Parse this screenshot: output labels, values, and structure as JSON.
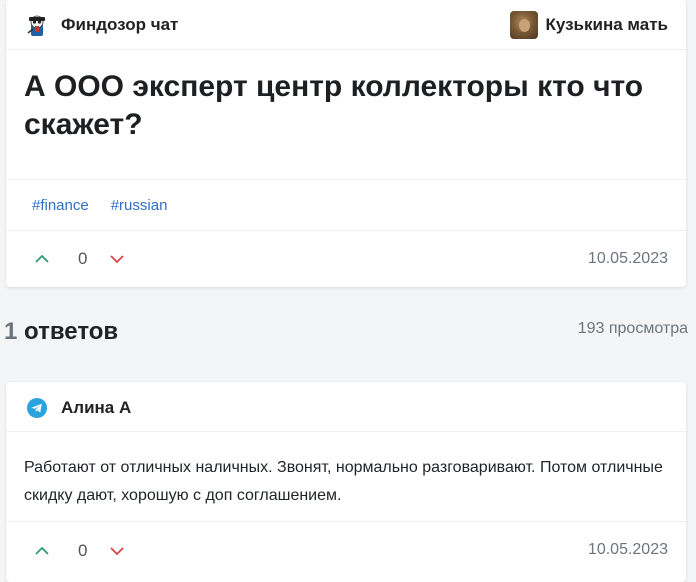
{
  "question": {
    "chat_name": "Финдозор чат",
    "author": "Кузькина мать",
    "title": "А ООО эксперт центр коллекторы кто что скажет?",
    "tags": [
      "#finance",
      "#russian"
    ],
    "score": "0",
    "date": "10.05.2023"
  },
  "answers_header": {
    "count": "1",
    "label": "ответов",
    "views": "193 просмотра"
  },
  "answer": {
    "author": "Алина А",
    "text": "Работают от отличных наличных. Звонят, нормально разговаривают. Потом отличные скидку дают, хорошую с доп соглашением.",
    "score": "0",
    "date": "10.05.2023"
  },
  "colors": {
    "upvote": "#2e9e6e",
    "downvote": "#d64545",
    "tag": "#2f6fc4",
    "telegram": "#2aa3df"
  },
  "icons": {
    "chat_avatar": "spy-mascot-icon",
    "source": "telegram-icon",
    "upvote": "chevron-up-icon",
    "downvote": "chevron-down-icon"
  }
}
